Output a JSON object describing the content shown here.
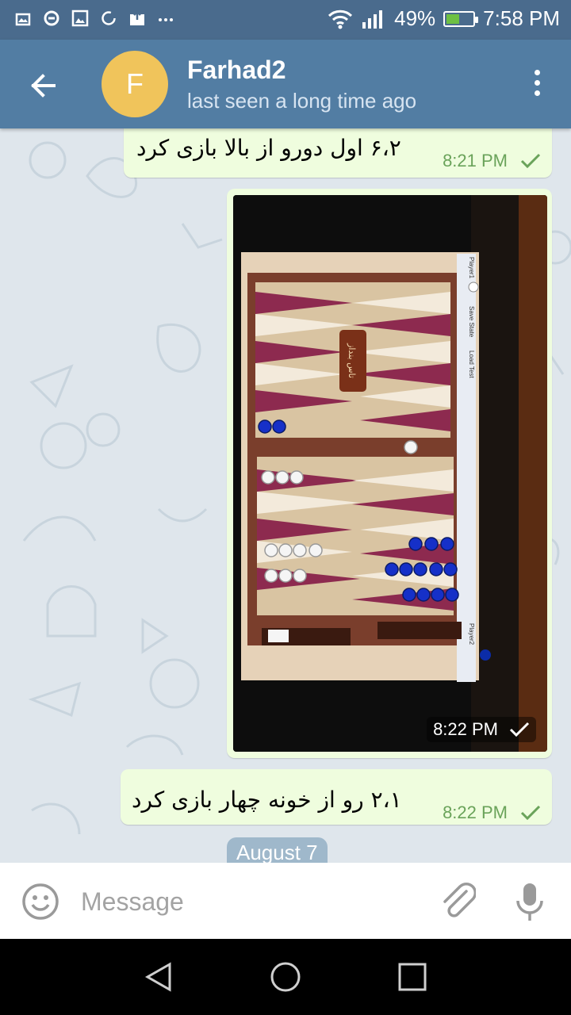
{
  "status_bar": {
    "battery": "49%",
    "battery_level": 0.49,
    "time": "7:58 PM",
    "icons": [
      "gallery-icon",
      "sync-icon",
      "image-icon",
      "refresh-icon",
      "upload-icon",
      "more-notifications-icon",
      "wifi-icon",
      "signal-icon",
      "battery-icon"
    ]
  },
  "header": {
    "avatar_letter": "F",
    "avatar_color": "#f0c45b",
    "title": "Farhad2",
    "subtitle": "last seen a long time ago"
  },
  "messages": [
    {
      "text": "۶،۲ اول دورو از بالا بازی کرد",
      "time": "8:21 PM",
      "status": "sent"
    },
    {
      "type": "photo",
      "time": "8:22 PM",
      "status": "sent",
      "photo_text": {
        "panel_label": "تاس بنداز",
        "player1": "Player1",
        "player2": "Player2",
        "save_state": "Save State",
        "load_test": "Load Test"
      }
    },
    {
      "text": "۲،۱ رو از خونه چهار بازی کرد",
      "time": "8:22 PM",
      "status": "sent"
    }
  ],
  "date_chip": "August 7",
  "input": {
    "placeholder": "Message"
  },
  "colors": {
    "header": "#527da3",
    "status_bar": "#4a6b8d",
    "bubble": "#effdde",
    "check": "#6aa35a"
  }
}
